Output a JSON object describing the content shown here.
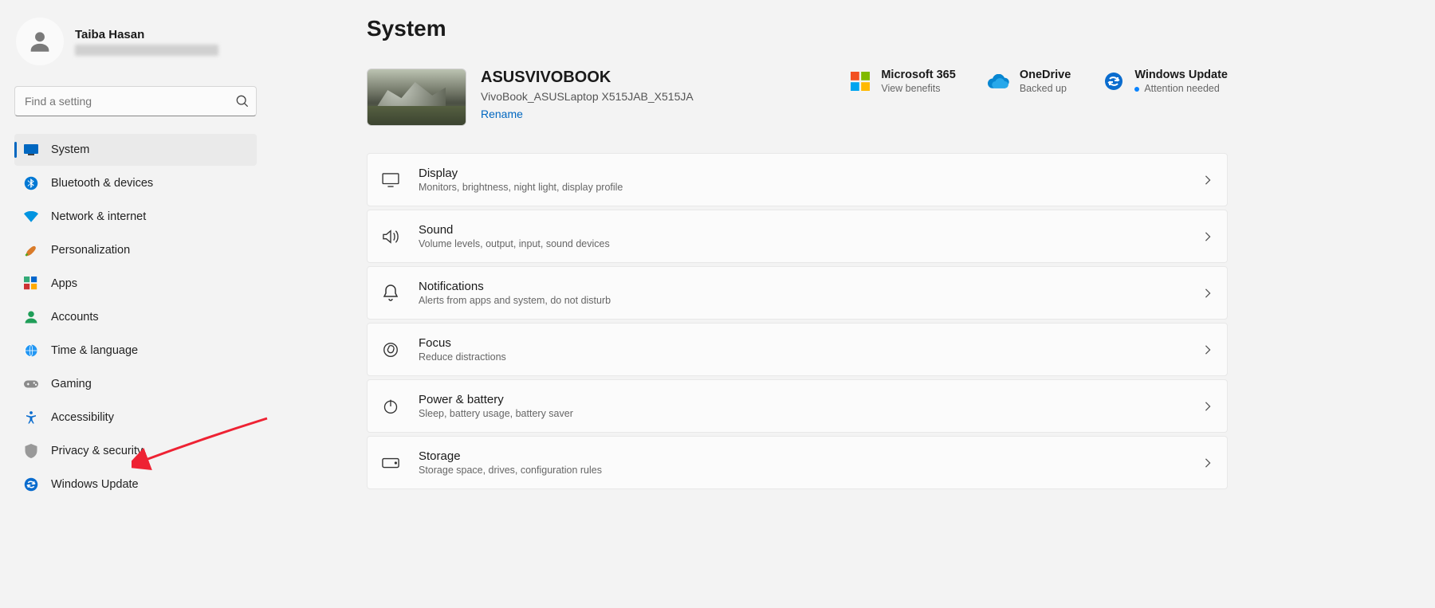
{
  "user": {
    "name": "Taiba Hasan"
  },
  "search": {
    "placeholder": "Find a setting"
  },
  "nav": [
    {
      "key": "system",
      "label": "System",
      "active": true
    },
    {
      "key": "bluetooth",
      "label": "Bluetooth & devices"
    },
    {
      "key": "network",
      "label": "Network & internet"
    },
    {
      "key": "personalization",
      "label": "Personalization"
    },
    {
      "key": "apps",
      "label": "Apps"
    },
    {
      "key": "accounts",
      "label": "Accounts"
    },
    {
      "key": "time",
      "label": "Time & language"
    },
    {
      "key": "gaming",
      "label": "Gaming"
    },
    {
      "key": "accessibility",
      "label": "Accessibility"
    },
    {
      "key": "privacy",
      "label": "Privacy & security"
    },
    {
      "key": "update",
      "label": "Windows Update"
    }
  ],
  "page": {
    "title": "System"
  },
  "device": {
    "name": "ASUSVIVOBOOK",
    "model": "VivoBook_ASUSLaptop X515JAB_X515JA",
    "rename_label": "Rename"
  },
  "quicklinks": {
    "m365": {
      "title": "Microsoft 365",
      "sub": "View benefits"
    },
    "onedrive": {
      "title": "OneDrive",
      "sub": "Backed up"
    },
    "winupdate": {
      "title": "Windows Update",
      "sub": "Attention needed"
    }
  },
  "cards": [
    {
      "key": "display",
      "title": "Display",
      "sub": "Monitors, brightness, night light, display profile"
    },
    {
      "key": "sound",
      "title": "Sound",
      "sub": "Volume levels, output, input, sound devices"
    },
    {
      "key": "notifications",
      "title": "Notifications",
      "sub": "Alerts from apps and system, do not disturb"
    },
    {
      "key": "focus",
      "title": "Focus",
      "sub": "Reduce distractions"
    },
    {
      "key": "power",
      "title": "Power & battery",
      "sub": "Sleep, battery usage, battery saver"
    },
    {
      "key": "storage",
      "title": "Storage",
      "sub": "Storage space, drives, configuration rules"
    }
  ]
}
